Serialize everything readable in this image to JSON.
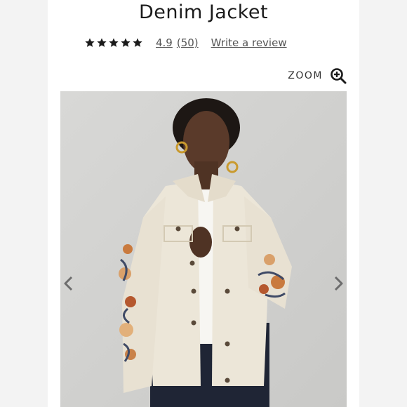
{
  "product": {
    "title": "Denim Jacket",
    "rating_value": "4.9",
    "review_count": "(50)",
    "write_review_label": "Write a review",
    "star_count": 5
  },
  "zoom": {
    "label": "ZOOM"
  },
  "gallery": {
    "prev_icon": "chevron-left-icon",
    "next_icon": "chevron-right-icon"
  },
  "colors": {
    "star": "#1b1b1b",
    "background": "#f3f3f3",
    "photo_backdrop": "#d2d2d0",
    "jacket": "#ece6d8"
  }
}
